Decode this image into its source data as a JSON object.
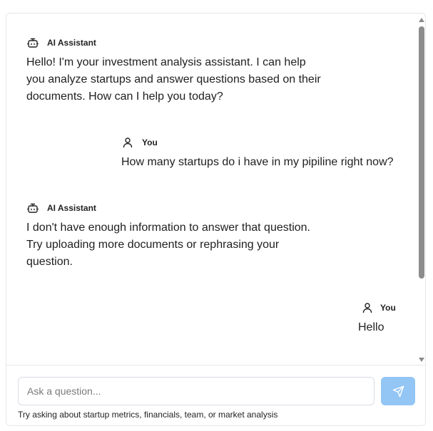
{
  "chat": {
    "messages": [
      {
        "role": "assistant",
        "sender": "AI Assistant",
        "icon": "bot-icon",
        "lines": [
          "Hello! I'm your investment analysis assistant. I can help",
          "you analyze startups and answer questions based on their",
          "documents. How can I help you today?"
        ]
      },
      {
        "role": "user",
        "sender": "You",
        "icon": "user-icon",
        "lines": [
          "How many startups do i have in my pipiline right now?"
        ]
      },
      {
        "role": "assistant",
        "sender": "AI Assistant",
        "icon": "bot-icon",
        "lines": [
          "I don't have enough information to answer that question.",
          "Try uploading more documents or rephrasing your",
          "question."
        ]
      },
      {
        "role": "user",
        "sender": "You",
        "icon": "user-icon",
        "lines": [
          "Hello"
        ]
      }
    ]
  },
  "composer": {
    "placeholder": "Ask a question...",
    "value": "",
    "send_icon": "send-icon",
    "hint": "Try asking about startup metrics, financials, team, or market analysis"
  },
  "colors": {
    "send_button": "#93c5f5",
    "border": "#e5e7eb",
    "scrollbar_thumb": "#8c8c8c"
  }
}
